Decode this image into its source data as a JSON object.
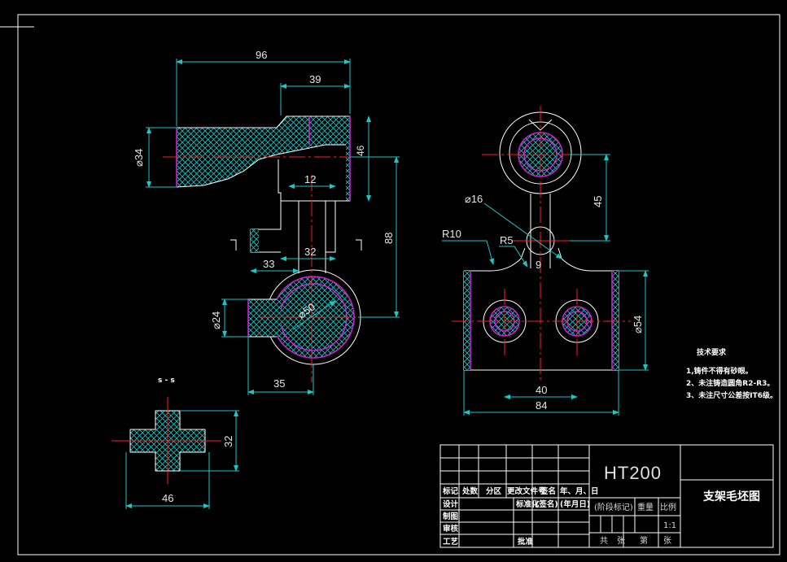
{
  "drawing_title": "支架毛坯图",
  "material": "HT200",
  "dimensions": {
    "top_len_96": "96",
    "top_len_39": "39",
    "dia_34": "⌀34",
    "len_46_side": "46",
    "len_12": "12",
    "len_88": "88",
    "len_32_top": "32",
    "len_33": "33",
    "dia_24": "⌀24",
    "dia_50": "⌀50",
    "len_35": "35",
    "dia_16": "⌀16",
    "r10": "R10",
    "r5": "R5",
    "len_9": "9",
    "len_45": "45",
    "dia_54": "⌀54",
    "len_40": "40",
    "len_84": "84",
    "sec_32": "32",
    "sec_46": "46"
  },
  "section_label": "s - s",
  "tech_requirements": {
    "heading": "技术要求",
    "items": [
      "1,铸件不得有砂眼。",
      "2、未注铸造圆角R2-R3。",
      "3、未注尺寸公差按IT6级。"
    ]
  },
  "title_block": {
    "row_labels": [
      "标记",
      "处数",
      "分区",
      "更改文件号",
      "签名",
      "年、月、日"
    ],
    "design": "设计",
    "standardization": "标准化",
    "signature": "(签名)",
    "date": "(年月日)",
    "drafting": "制图",
    "review": "审核",
    "process": "工艺",
    "approve": "批准",
    "stage_mark": "(阶段标记)",
    "weight": "重量",
    "scale": "比例",
    "scale_value": "1:1",
    "sheets_total": "共",
    "sheets_label1": "张",
    "sheet_no": "第",
    "sheets_label2": "张"
  }
}
